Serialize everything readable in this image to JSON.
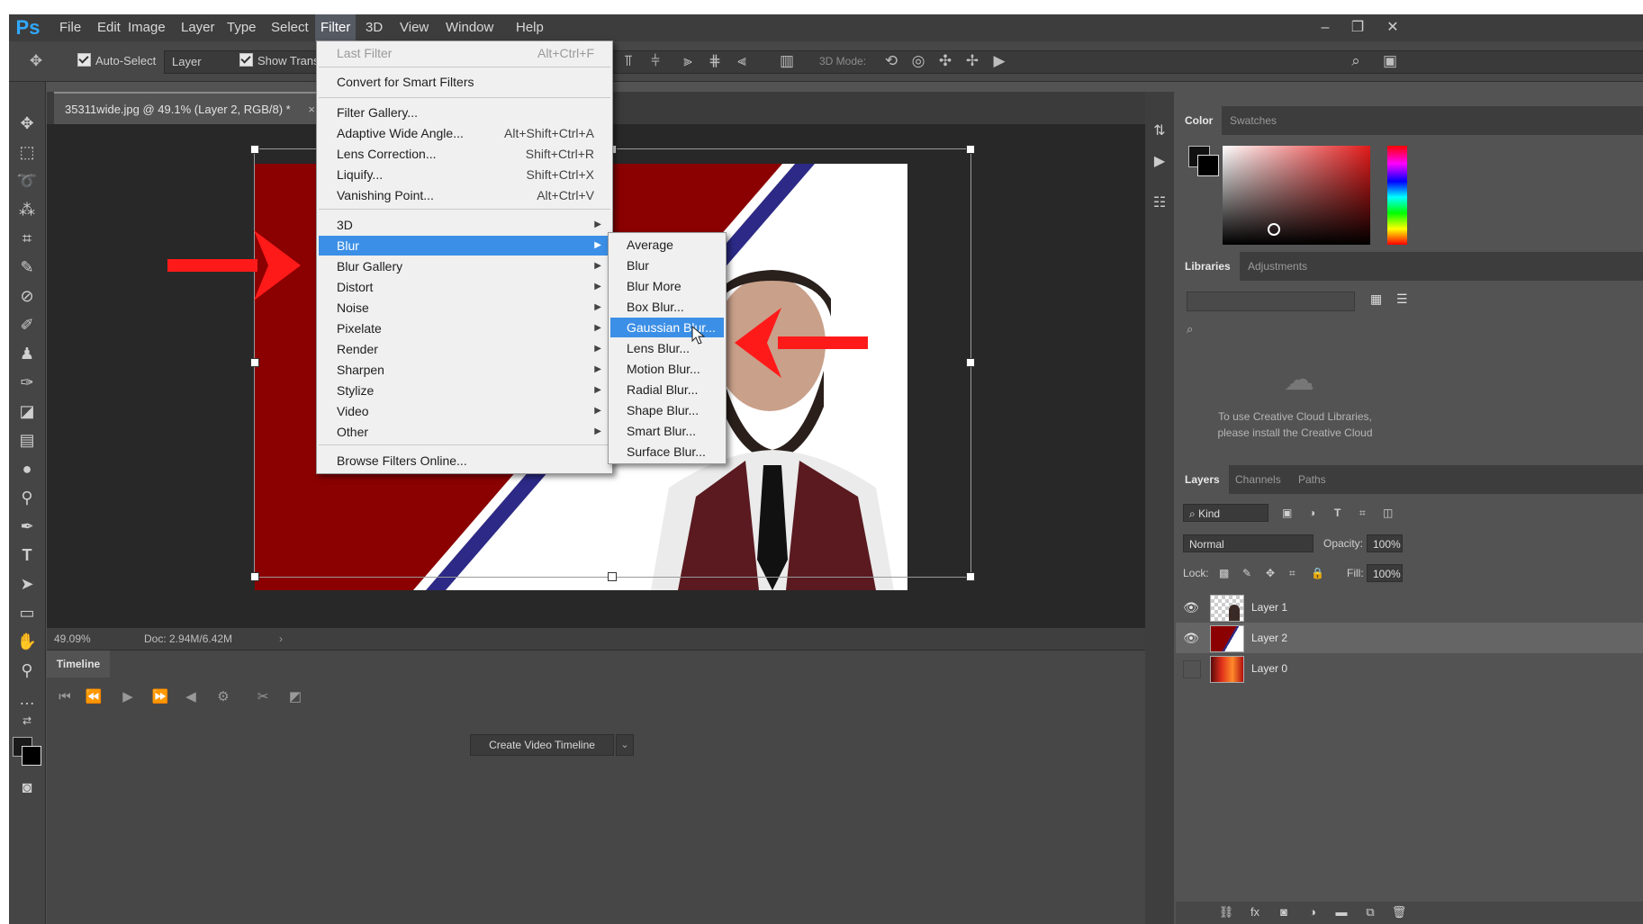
{
  "app": {
    "logo": "Ps"
  },
  "menubar": {
    "items": [
      "File",
      "Edit",
      "Image",
      "Layer",
      "Type",
      "Select",
      "Filter",
      "3D",
      "View",
      "Window",
      "Help"
    ],
    "active": "Filter"
  },
  "options": {
    "auto_select_label": "Auto-Select",
    "auto_select_value": "Layer",
    "show_transform_label": "Show Trans",
    "mode_3d_label": "3D Mode:"
  },
  "document": {
    "tab_title": "35311wide.jpg @ 49.1% (Layer 2, RGB/8) *",
    "zoom": "49.09%",
    "doc_info": "Doc: 2.94M/6.42M"
  },
  "filter_menu": {
    "items": [
      {
        "label": "Last Filter",
        "shortcut": "Alt+Ctrl+F",
        "disabled": true
      },
      {
        "label": "Convert for Smart Filters",
        "shortcut": ""
      },
      {
        "label": "Filter Gallery...",
        "shortcut": ""
      },
      {
        "label": "Adaptive Wide Angle...",
        "shortcut": "Alt+Shift+Ctrl+A"
      },
      {
        "label": "Lens Correction...",
        "shortcut": "Shift+Ctrl+R"
      },
      {
        "label": "Liquify...",
        "shortcut": "Shift+Ctrl+X"
      },
      {
        "label": "Vanishing Point...",
        "shortcut": "Alt+Ctrl+V"
      },
      {
        "label": "3D",
        "shortcut": ""
      },
      {
        "label": "Blur",
        "shortcut": ""
      },
      {
        "label": "Blur Gallery",
        "shortcut": ""
      },
      {
        "label": "Distort",
        "shortcut": ""
      },
      {
        "label": "Noise",
        "shortcut": ""
      },
      {
        "label": "Pixelate",
        "shortcut": ""
      },
      {
        "label": "Render",
        "shortcut": ""
      },
      {
        "label": "Sharpen",
        "shortcut": ""
      },
      {
        "label": "Stylize",
        "shortcut": ""
      },
      {
        "label": "Video",
        "shortcut": ""
      },
      {
        "label": "Other",
        "shortcut": ""
      },
      {
        "label": "Browse Filters Online...",
        "shortcut": ""
      }
    ],
    "highlighted": "Blur"
  },
  "blur_submenu": {
    "items": [
      "Average",
      "Blur",
      "Blur More",
      "Box Blur...",
      "Gaussian Blur...",
      "Lens Blur...",
      "Motion Blur...",
      "Radial Blur...",
      "Shape Blur...",
      "Smart Blur...",
      "Surface Blur..."
    ],
    "highlighted": "Gaussian Blur..."
  },
  "timeline": {
    "tab": "Timeline",
    "create_button": "Create Video Timeline"
  },
  "color_panel": {
    "tabs": [
      "Color",
      "Swatches"
    ]
  },
  "libraries_panel": {
    "tabs": [
      "Libraries",
      "Adjustments"
    ],
    "message_line1": "To use Creative Cloud Libraries,",
    "message_line2": "please install the Creative Cloud"
  },
  "layers_panel": {
    "tabs": [
      "Layers",
      "Channels",
      "Paths"
    ],
    "filter_kind": "Kind",
    "blend_mode": "Normal",
    "opacity_label": "Opacity:",
    "opacity_value": "100%",
    "lock_label": "Lock:",
    "fill_label": "Fill:",
    "fill_value": "100%",
    "layers": [
      {
        "name": "Layer 1",
        "visible": true,
        "selected": false
      },
      {
        "name": "Layer 2",
        "visible": true,
        "selected": true
      },
      {
        "name": "Layer 0",
        "visible": false,
        "selected": false
      }
    ]
  },
  "colors": {
    "menu_highlight": "#3c8fe6",
    "annotation_arrow": "#ff1a1a",
    "artwork_red": "#8b0000",
    "ps_blue": "#31a8ff"
  }
}
